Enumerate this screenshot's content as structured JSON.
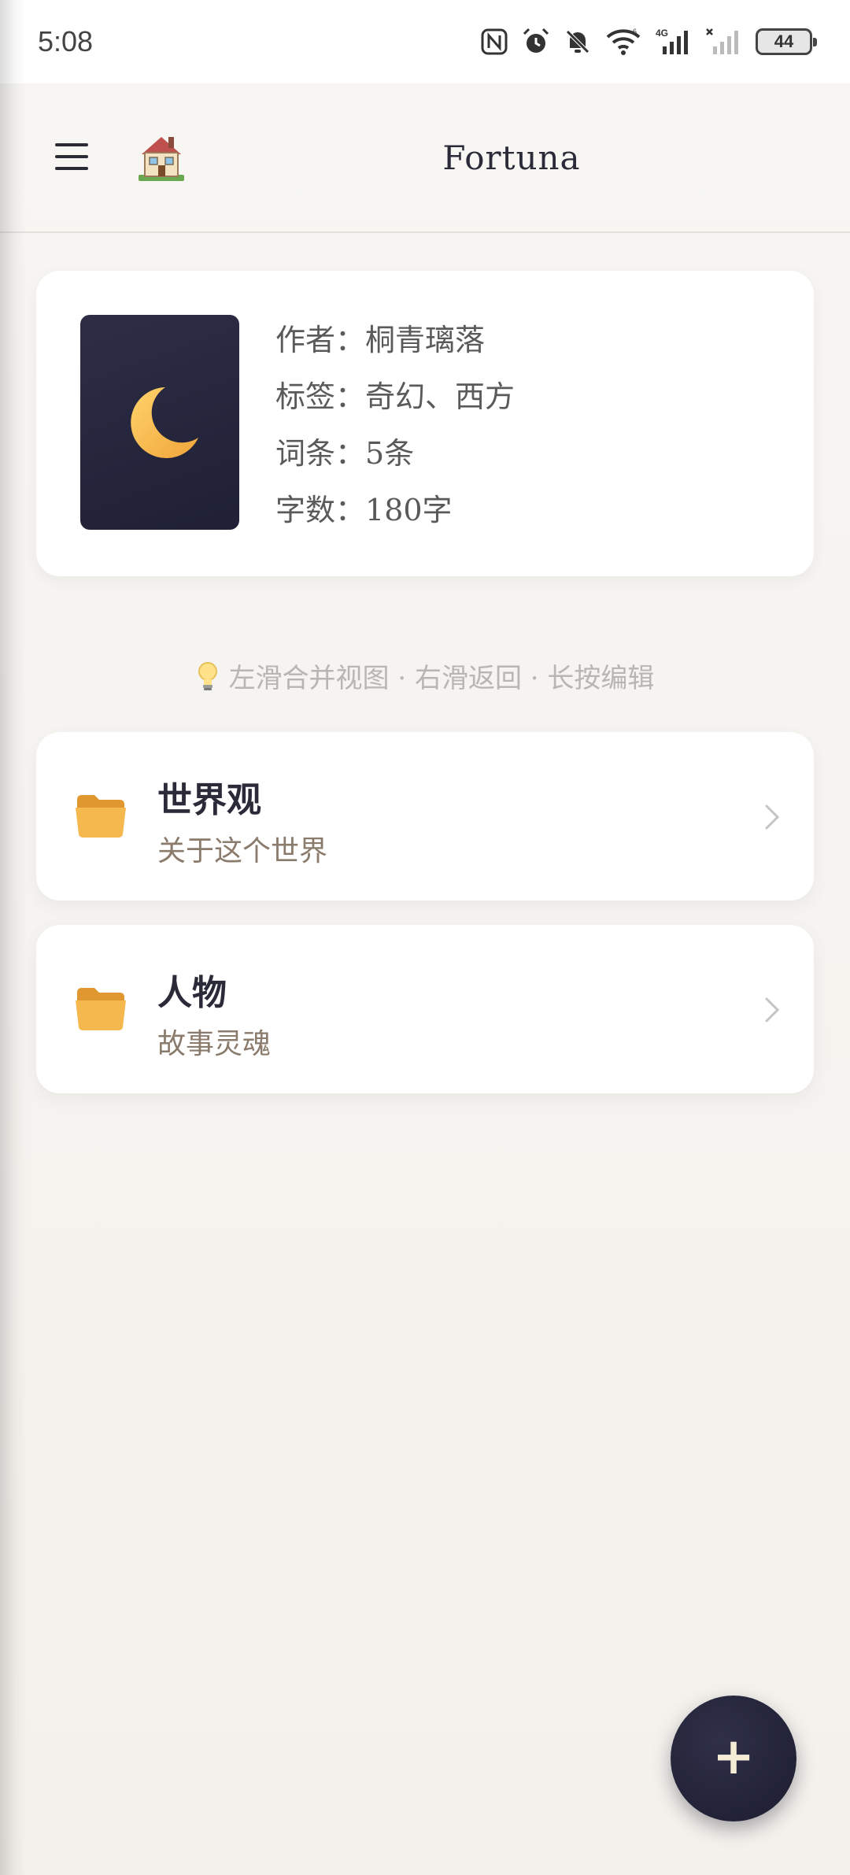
{
  "status_bar": {
    "time": "5:08",
    "battery": "44",
    "icons": [
      "nfc-icon",
      "alarm-icon",
      "mute-icon",
      "wifi-icon",
      "signal-4g-icon",
      "signal-no-service-icon",
      "battery-icon"
    ]
  },
  "app_bar": {
    "title": "Fortuna",
    "menu_icon": "hamburger-menu-icon",
    "home_icon": "house-icon"
  },
  "book": {
    "cover_icon": "crescent-moon-icon",
    "author_label": "作者：",
    "author": "桐青璃落",
    "tags_label": "标签：",
    "tags": "奇幻、西方",
    "entries_label": "词条：",
    "entries": "5条",
    "words_label": "字数：",
    "words": "180字"
  },
  "hint": {
    "icon": "lightbulb-icon",
    "text": "左滑合并视图 · 右滑返回 · 长按编辑"
  },
  "categories": [
    {
      "name": "世界观",
      "desc": "关于这个世界",
      "icon": "folder-icon"
    },
    {
      "name": "人物",
      "desc": "故事灵魂",
      "icon": "folder-icon"
    }
  ],
  "fab": {
    "label": "+"
  },
  "colors": {
    "accent_dark": "#1f2035",
    "background": "#f5f3ef",
    "card": "#ffffff",
    "subtitle": "#8a7b6c",
    "folder": "#f0b04a"
  }
}
